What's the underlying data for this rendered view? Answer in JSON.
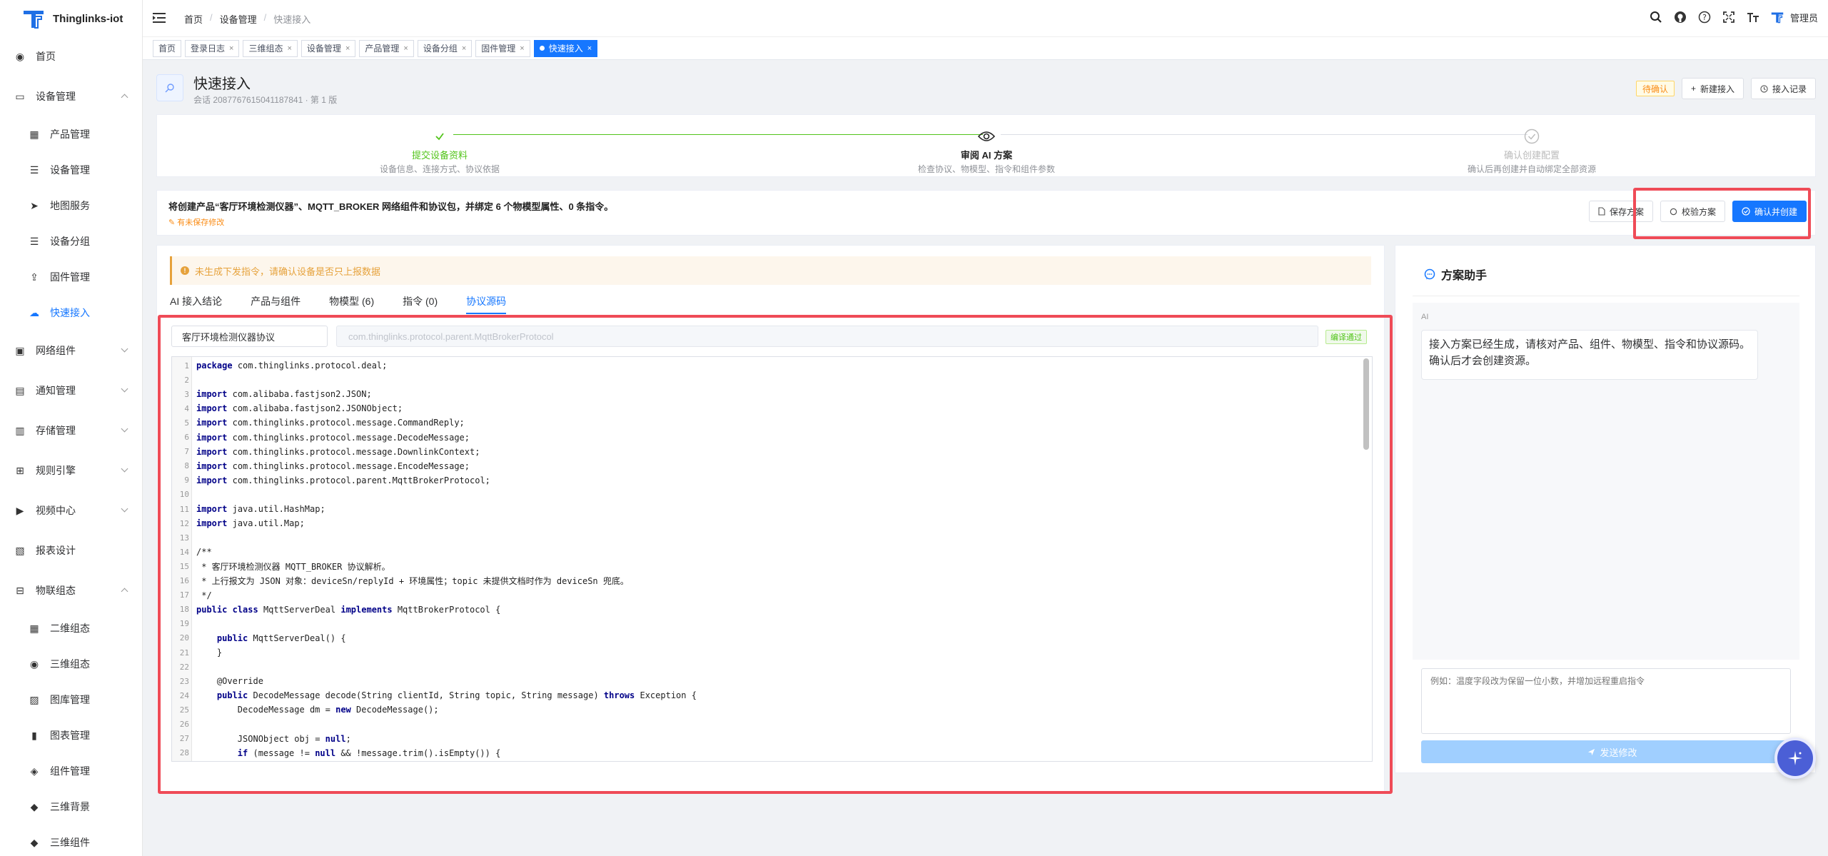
{
  "app": {
    "name": "Thinglinks-iot"
  },
  "sidebar": {
    "items": [
      {
        "label": "首页",
        "icon": "dashboard-icon"
      },
      {
        "label": "设备管理",
        "icon": "device-icon"
      },
      {
        "label": "产品管理",
        "icon": "grid-icon"
      },
      {
        "label": "设备管理",
        "icon": "list-icon"
      },
      {
        "label": "地图服务",
        "icon": "send-icon"
      },
      {
        "label": "设备分组",
        "icon": "list-icon"
      },
      {
        "label": "固件管理",
        "icon": "upload-icon"
      },
      {
        "label": "快速接入",
        "icon": "cloud-icon"
      },
      {
        "label": "网络组件",
        "icon": "network-icon"
      },
      {
        "label": "通知管理",
        "icon": "message-icon"
      },
      {
        "label": "存储管理",
        "icon": "storage-icon"
      },
      {
        "label": "规则引擎",
        "icon": "hierarchy-icon"
      },
      {
        "label": "视频中心",
        "icon": "video-icon"
      },
      {
        "label": "报表设计",
        "icon": "report-icon"
      },
      {
        "label": "物联组态",
        "icon": "layout-icon"
      },
      {
        "label": "二维组态",
        "icon": "grid-icon"
      },
      {
        "label": "三维组态",
        "icon": "dashboard-icon"
      },
      {
        "label": "图库管理",
        "icon": "image-icon"
      },
      {
        "label": "图表管理",
        "icon": "chart-icon"
      },
      {
        "label": "组件管理",
        "icon": "component-icon"
      },
      {
        "label": "三维背景",
        "icon": "cube-icon"
      },
      {
        "label": "三维组件",
        "icon": "cube-icon"
      }
    ]
  },
  "header": {
    "breadcrumb": [
      "首页",
      "设备管理",
      "快速接入"
    ],
    "user": "管理员"
  },
  "tags": [
    {
      "label": "首页"
    },
    {
      "label": "登录日志"
    },
    {
      "label": "三维组态"
    },
    {
      "label": "设备管理"
    },
    {
      "label": "产品管理"
    },
    {
      "label": "设备分组"
    },
    {
      "label": "固件管理"
    },
    {
      "label": "快速接入"
    }
  ],
  "page": {
    "title": "快速接入",
    "subtitle": "会话 2087767615041187841 · 第 1 版",
    "status_badge": "待确认",
    "new_button": "新建接入",
    "history_button": "接入记录"
  },
  "steps": [
    {
      "title": "提交设备资料",
      "desc": "设备信息、连接方式、协议依据",
      "state": "done"
    },
    {
      "title": "审阅 AI 方案",
      "desc": "检查协议、物模型、指令和组件参数",
      "state": "current"
    },
    {
      "title": "确认创建配置",
      "desc": "确认后再创建并自动绑定全部资源",
      "state": "wait"
    }
  ],
  "summary": {
    "text": "将创建产品“客厅环境检测仪器”、MQTT_BROKER 网络组件和协议包，并绑定 6 个物模型属性、0 条指令。",
    "unsaved": "有未保存修改",
    "save_button": "保存方案",
    "validate_button": "校验方案",
    "confirm_button": "确认并创建"
  },
  "main": {
    "warning": "未生成下发指令，请确认设备是否只上报数据",
    "tabs": [
      "AI 接入结论",
      "产品与组件",
      "物模型 (6)",
      "指令 (0)",
      "协议源码"
    ],
    "active_tab": 4,
    "protocol_name": "客厅环境检测仪器协议",
    "protocol_class": "com.thinglinks.protocol.parent.MqttBrokerProtocol",
    "compile_status": "编译通过",
    "code_lines": [
      "package com.thinglinks.protocol.deal;",
      "",
      "import com.alibaba.fastjson2.JSON;",
      "import com.alibaba.fastjson2.JSONObject;",
      "import com.thinglinks.protocol.message.CommandReply;",
      "import com.thinglinks.protocol.message.DecodeMessage;",
      "import com.thinglinks.protocol.message.DownlinkContext;",
      "import com.thinglinks.protocol.message.EncodeMessage;",
      "import com.thinglinks.protocol.parent.MqttBrokerProtocol;",
      "",
      "import java.util.HashMap;",
      "import java.util.Map;",
      "",
      "/**",
      " * 客厅环境检测仪器 MQTT_BROKER 协议解析。",
      " * 上行报文为 JSON 对象：deviceSn/replyId + 环境属性；topic 未提供文档时作为 deviceSn 兜底。",
      " */",
      "public class MqttServerDeal implements MqttBrokerProtocol {",
      "",
      "    public MqttServerDeal() {",
      "    }",
      "",
      "    @Override",
      "    public DecodeMessage decode(String clientId, String topic, String message) throws Exception {",
      "        DecodeMessage dm = new DecodeMessage();",
      "",
      "        JSONObject obj = null;",
      "        if (message != null && !message.trim().isEmpty()) {"
    ]
  },
  "assistant": {
    "title": "方案助手",
    "ai_label": "AI",
    "message": "接入方案已经生成，请核对产品、组件、物模型、指令和协议源码。确认后才会创建资源。",
    "input_placeholder": "例如：温度字段改为保留一位小数，并增加远程重启指令",
    "send_button": "发送修改"
  },
  "colors": {
    "primary": "#1677ff",
    "success": "#52c41a",
    "warning": "#e6a23c",
    "highlight": "#ef4b57"
  }
}
